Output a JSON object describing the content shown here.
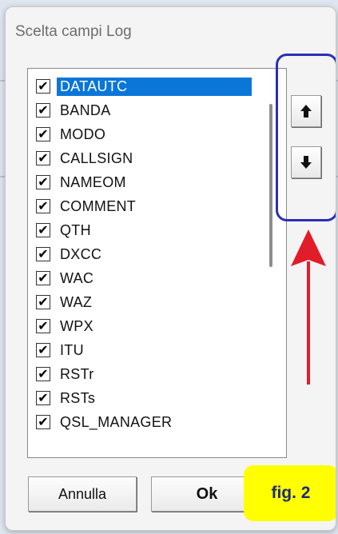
{
  "window": {
    "title": "Scelta campi Log"
  },
  "fields": [
    {
      "label": "DATAUTC",
      "checked": true,
      "selected": true
    },
    {
      "label": "BANDA",
      "checked": true
    },
    {
      "label": "MODO",
      "checked": true
    },
    {
      "label": "CALLSIGN",
      "checked": true
    },
    {
      "label": "NAMEOM",
      "checked": true
    },
    {
      "label": "COMMENT",
      "checked": true
    },
    {
      "label": "QTH",
      "checked": true
    },
    {
      "label": "DXCC",
      "checked": true
    },
    {
      "label": "WAC",
      "checked": true
    },
    {
      "label": "WAZ",
      "checked": true
    },
    {
      "label": "WPX",
      "checked": true
    },
    {
      "label": "ITU",
      "checked": true
    },
    {
      "label": "RSTr",
      "checked": true
    },
    {
      "label": "RSTs",
      "checked": true
    },
    {
      "label": "QSL_MANAGER",
      "checked": true
    }
  ],
  "controls": {
    "cancel_label": "Annulla",
    "ok_label": "Ok"
  },
  "annotation": {
    "fig_label": "fig. 2",
    "highlight_color": "#2a2fb8",
    "arrow_color": "#e11d2a"
  },
  "icons": {
    "move_up": "arrow-up-icon",
    "move_down": "arrow-down-icon",
    "check": "check-icon"
  }
}
